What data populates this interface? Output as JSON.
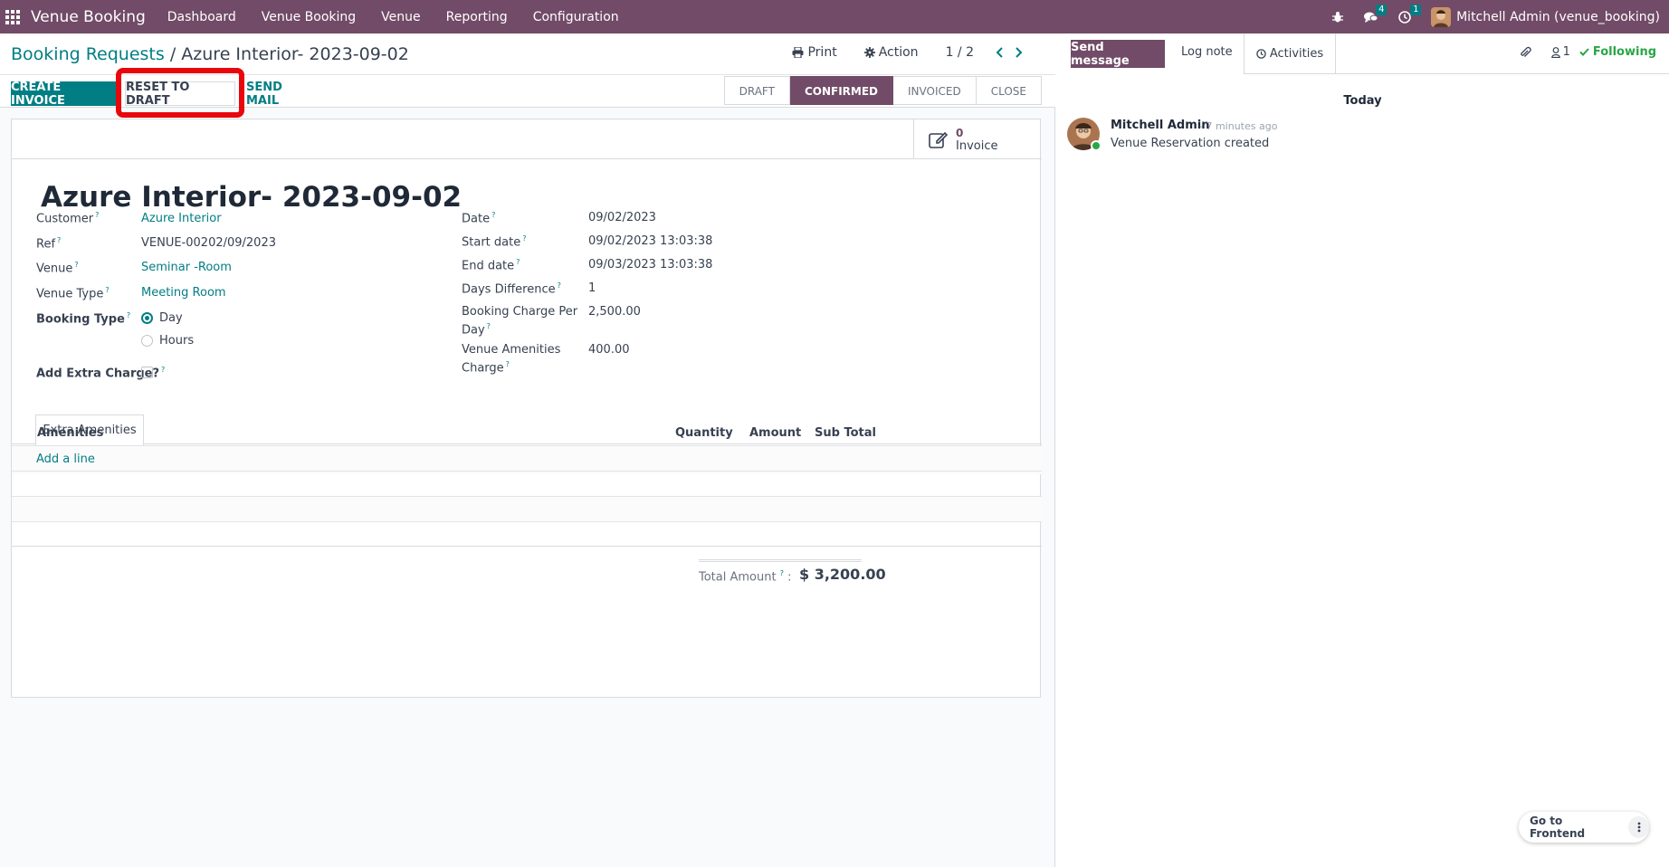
{
  "navbar": {
    "brand": "Venue Booking",
    "menu": [
      "Dashboard",
      "Venue Booking",
      "Venue",
      "Reporting",
      "Configuration"
    ],
    "messages_count": "4",
    "activities_count": "1",
    "user": "Mitchell Admin (venue_booking)",
    "accent": "#714b67"
  },
  "control_panel": {
    "breadcrumb_parent": "Booking Requests",
    "breadcrumb_sep": "/",
    "breadcrumb_current": "Azure Interior- 2023-09-02",
    "print": "Print",
    "action": "Action",
    "pager": "1 / 2"
  },
  "buttons": {
    "create_invoice": "CREATE INVOICE",
    "reset_to_draft": "RESET TO DRAFT",
    "send_mail": "SEND MAIL"
  },
  "statusbar": {
    "stages": [
      "DRAFT",
      "CONFIRMED",
      "INVOICED",
      "CLOSE"
    ],
    "active": "CONFIRMED"
  },
  "smart_button": {
    "value": "0",
    "label": "Invoice"
  },
  "form": {
    "title": "Azure Interior- 2023-09-02",
    "customer_label": "Customer",
    "customer": "Azure Interior",
    "ref_label": "Ref",
    "ref": "VENUE-00202/09/2023",
    "venue_label": "Venue",
    "venue": "Seminar -Room",
    "venue_type_label": "Venue Type",
    "venue_type": "Meeting Room",
    "booking_type_label": "Booking Type",
    "booking_type_options": [
      "Day",
      "Hours"
    ],
    "booking_type_selected": "Day",
    "extra_charge_label": "Add Extra Charge?",
    "extra_charge_checked": false,
    "date_label": "Date",
    "date": "09/02/2023",
    "start_label": "Start date",
    "start": "09/02/2023 13:03:38",
    "end_label": "End date",
    "end": "09/03/2023 13:03:38",
    "days_label": "Days Difference",
    "days": "1",
    "charge_label_1": "Booking Charge Per",
    "charge_label_2": "Day",
    "charge": "2,500.00",
    "amenities_label_1": "Venue Amenities",
    "amenities_label_2": "Charge",
    "amenities_charge": "400.00",
    "help_mark": "?"
  },
  "tabs": {
    "extra_amenities": "Extra Amenities"
  },
  "table": {
    "columns": [
      "Amenities",
      "Quantity",
      "Amount",
      "Sub Total"
    ],
    "add_line": "Add a line"
  },
  "total": {
    "label": "Total Amount",
    "colon": ":",
    "value": "$ 3,200.00"
  },
  "chatter": {
    "send_message": "Send message",
    "log_note": "Log note",
    "activities": "Activities",
    "followers": "1",
    "following": "Following",
    "today": "Today",
    "author": "Mitchell Admin",
    "time": "- 7 minutes ago",
    "body": "Venue Reservation created"
  },
  "frontend_button": "Go to Frontend"
}
